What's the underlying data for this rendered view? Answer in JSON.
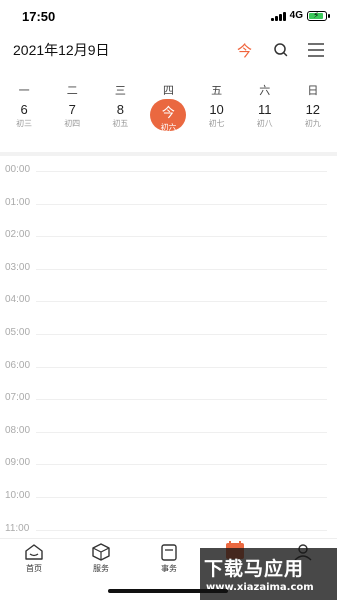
{
  "status_bar": {
    "time": "17:50",
    "network": "4G"
  },
  "header": {
    "date": "2021年12月9日",
    "today_label": "今"
  },
  "weekdays": [
    "一",
    "二",
    "三",
    "四",
    "五",
    "六",
    "日"
  ],
  "days": [
    {
      "num": "6",
      "lunar": "初三",
      "selected": false
    },
    {
      "num": "7",
      "lunar": "初四",
      "selected": false
    },
    {
      "num": "8",
      "lunar": "初五",
      "selected": false
    },
    {
      "num": "今",
      "lunar": "初六",
      "selected": true
    },
    {
      "num": "10",
      "lunar": "初七",
      "selected": false
    },
    {
      "num": "11",
      "lunar": "初八",
      "selected": false
    },
    {
      "num": "12",
      "lunar": "初九",
      "selected": false
    }
  ],
  "times": [
    "00:00",
    "01:00",
    "02:00",
    "03:00",
    "04:00",
    "05:00",
    "06:00",
    "07:00",
    "08:00",
    "09:00",
    "10:00",
    "11:00"
  ],
  "tabbar": {
    "home": "首页",
    "service": "服务",
    "affairs": "事务",
    "accent": "#ea6840"
  },
  "watermark": {
    "main": "下载马应用",
    "sub": "www.xiazaima.com"
  }
}
